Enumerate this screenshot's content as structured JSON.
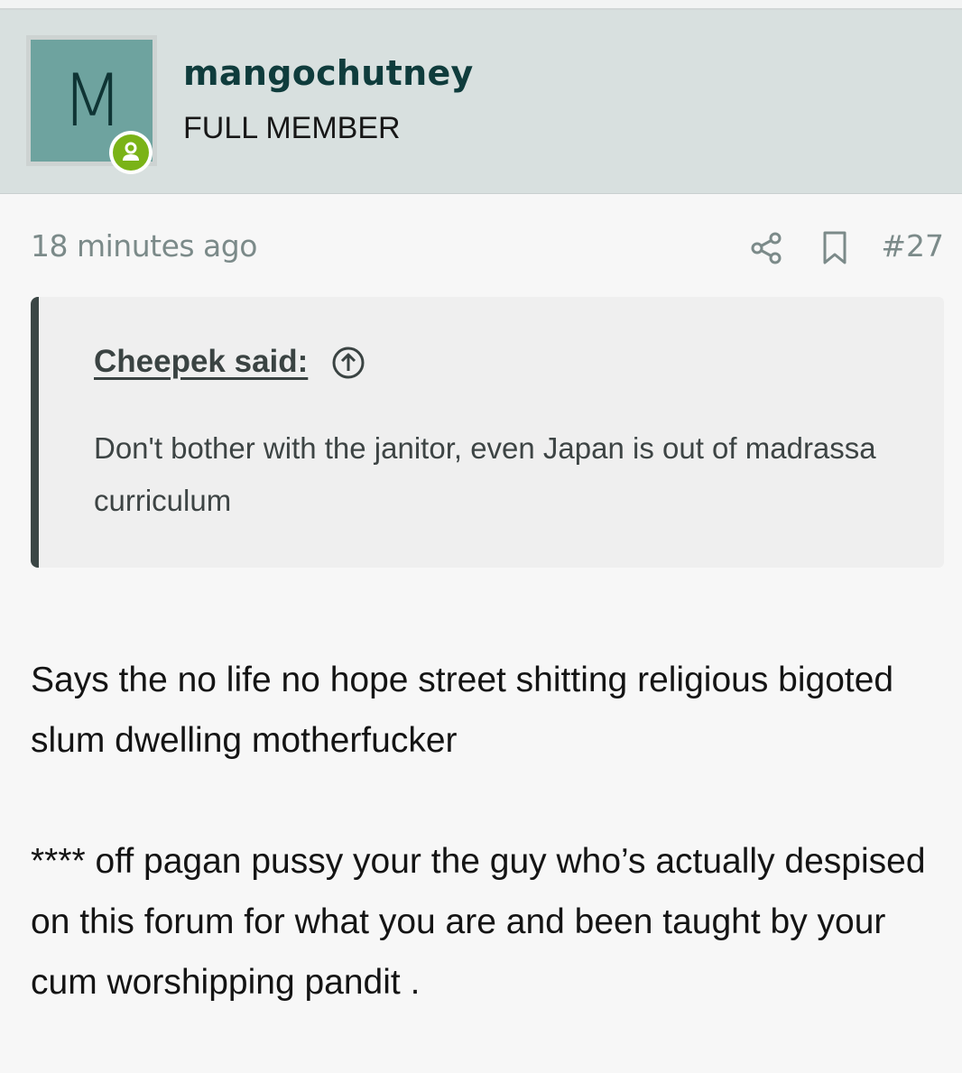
{
  "user": {
    "avatar_letter": "M",
    "username": "mangochutney",
    "title": "FULL MEMBER",
    "status_icon": "online-user-icon",
    "colors": {
      "avatar_bg": "#6ea39f",
      "header_bg": "#d8e0df",
      "online": "#7ab317"
    }
  },
  "post": {
    "timestamp": "18 minutes ago",
    "number": "#27",
    "icons": [
      "share-icon",
      "bookmark-icon"
    ],
    "quote": {
      "author": "Cheepek said:",
      "jump_icon": "arrow-up-circle-icon",
      "text": "Don't bother with the janitor, even Japan is out of madrassa curriculum"
    },
    "body": [
      "Says the no life no hope street shitting religious bigoted slum dwelling motherfucker",
      "**** off pagan pussy your the guy who’s actually despised on this forum for what you are and been taught by your cum worshipping pandit ."
    ]
  }
}
